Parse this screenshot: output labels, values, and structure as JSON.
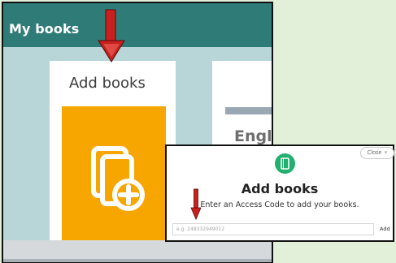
{
  "app": {
    "title": "My books",
    "add_card_label": "Add books",
    "book_card_title": "Engli"
  },
  "dialog": {
    "close_label": "Close",
    "close_icon": "×",
    "title": "Add books",
    "subtitle": "Enter an Access Code to add your books.",
    "input_placeholder": "e.g. 248332949012",
    "add_label": "Add",
    "icon": "book-icon"
  },
  "colors": {
    "header": "#2f7b78",
    "background": "#b8d6d8",
    "accent_orange": "#f7a600",
    "accent_green": "#21b06d",
    "annotation_red": "#c8201e"
  }
}
